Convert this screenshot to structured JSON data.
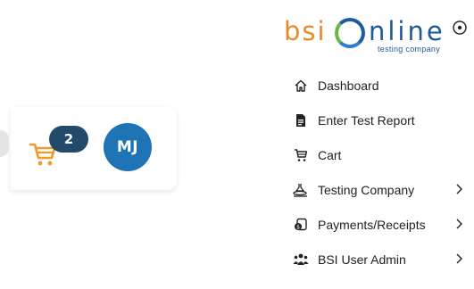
{
  "header": {
    "cart_count": "2",
    "avatar_initials": "MJ"
  },
  "logo": {
    "brand_left": "bsi",
    "brand_right": "nline",
    "tagline": "testing company"
  },
  "menu": {
    "items": [
      {
        "label": "Dashboard",
        "icon": "home-icon",
        "has_submenu": false
      },
      {
        "label": "Enter Test Report",
        "icon": "document-icon",
        "has_submenu": false
      },
      {
        "label": "Cart",
        "icon": "cart-icon",
        "has_submenu": false
      },
      {
        "label": "Testing Company",
        "icon": "lab-icon",
        "has_submenu": true
      },
      {
        "label": "Payments/Receipts",
        "icon": "payment-icon",
        "has_submenu": true
      },
      {
        "label": "BSI User Admin",
        "icon": "users-icon",
        "has_submenu": true
      }
    ]
  },
  "colors": {
    "brand_orange": "#e98a2a",
    "brand_blue": "#1e5a96",
    "badge_navy": "#234a6b",
    "avatar_blue": "#1f74b6"
  }
}
